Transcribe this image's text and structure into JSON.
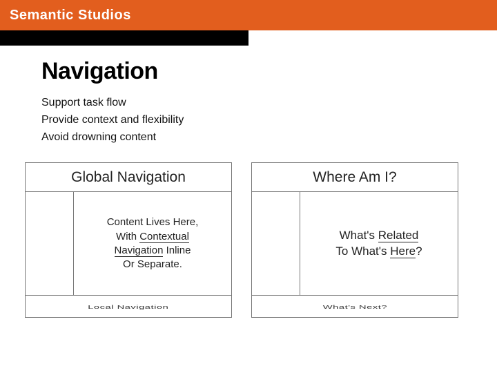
{
  "header": {
    "brand": "Semantic Studios"
  },
  "slide": {
    "title": "Navigation",
    "bullets": [
      "Support task flow",
      "Provide context and flexibility",
      "Avoid drowning content"
    ]
  },
  "panels": {
    "left": {
      "head": "Global Navigation",
      "main_l1": "Content Lives Here,",
      "main_l2a": "With ",
      "main_l2b": "Contextual",
      "main_l3a": "Navigation",
      "main_l3b": " Inline",
      "main_l4": "Or Separate.",
      "foot": "Local Navigation"
    },
    "right": {
      "head": "Where Am I?",
      "main_l1": "What's ",
      "main_l1u": "Related",
      "main_l2": "To What's ",
      "main_l2u": "Here",
      "main_l2q": "?",
      "foot": "What's Next?"
    }
  }
}
